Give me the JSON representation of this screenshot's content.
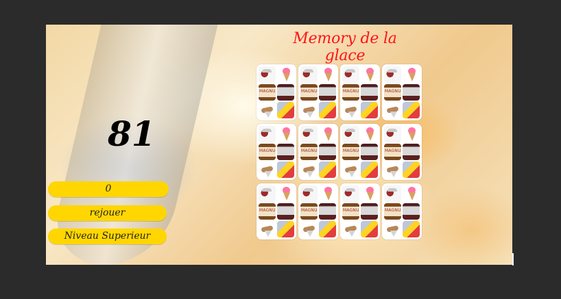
{
  "game": {
    "title": "Memory de la glace",
    "score": "81",
    "counter_value": "0",
    "buttons": {
      "replay": "rejouer",
      "next_level": "Niveau Superieur"
    }
  },
  "cards": [
    {
      "icons": [
        "ice-cream-tub-icon",
        "cone-icon",
        "magnum-icon",
        "bucket-icon",
        "cone-bar-icon",
        "twist-icon"
      ]
    },
    {
      "icons": [
        "ice-cream-tub-icon",
        "cone-icon",
        "magnum-icon",
        "bucket-icon",
        "cone-bar-icon",
        "twist-icon"
      ]
    },
    {
      "icons": [
        "ice-cream-tub-icon",
        "cone-icon",
        "magnum-icon",
        "bucket-icon",
        "cone-bar-icon",
        "twist-icon"
      ]
    },
    {
      "icons": [
        "ice-cream-tub-icon",
        "cone-icon",
        "magnum-icon",
        "bucket-icon",
        "cone-bar-icon",
        "twist-icon"
      ]
    },
    {
      "icons": [
        "ice-cream-tub-icon",
        "cone-icon",
        "magnum-icon",
        "bucket-icon",
        "cone-bar-icon",
        "twist-icon"
      ]
    },
    {
      "icons": [
        "ice-cream-tub-icon",
        "cone-icon",
        "magnum-icon",
        "bucket-icon",
        "cone-bar-icon",
        "twist-icon"
      ]
    },
    {
      "icons": [
        "ice-cream-tub-icon",
        "cone-icon",
        "magnum-icon",
        "bucket-icon",
        "cone-bar-icon",
        "twist-icon"
      ]
    },
    {
      "icons": [
        "ice-cream-tub-icon",
        "cone-icon",
        "magnum-icon",
        "bucket-icon",
        "cone-bar-icon",
        "twist-icon"
      ]
    },
    {
      "icons": [
        "ice-cream-tub-icon",
        "cone-icon",
        "magnum-icon",
        "bucket-icon",
        "cone-bar-icon",
        "twist-icon"
      ]
    },
    {
      "icons": [
        "ice-cream-tub-icon",
        "cone-icon",
        "magnum-icon",
        "bucket-icon",
        "cone-bar-icon",
        "twist-icon"
      ]
    },
    {
      "icons": [
        "ice-cream-tub-icon",
        "cone-icon",
        "magnum-icon",
        "bucket-icon",
        "cone-bar-icon",
        "twist-icon"
      ]
    },
    {
      "icons": [
        "ice-cream-tub-icon",
        "cone-icon",
        "magnum-icon",
        "bucket-icon",
        "cone-bar-icon",
        "twist-icon"
      ]
    }
  ],
  "colors": {
    "title": "#ff1212",
    "button": "#ffd600",
    "outer_background": "#2b2b2b"
  }
}
